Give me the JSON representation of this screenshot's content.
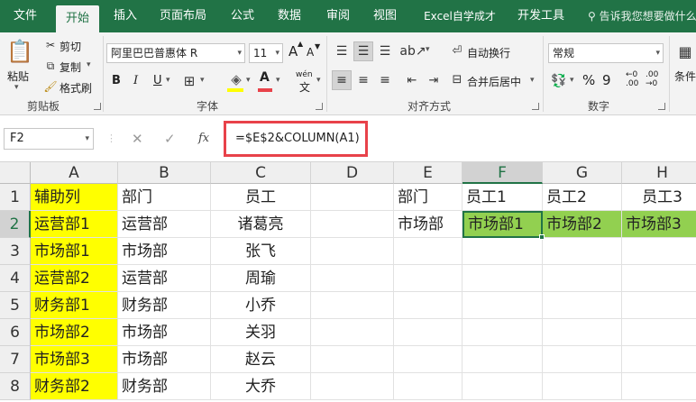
{
  "ribbon_tabs": [
    "文件",
    "开始",
    "插入",
    "页面布局",
    "公式",
    "数据",
    "审阅",
    "视图",
    "Excel自学成才",
    "开发工具"
  ],
  "active_tab": "开始",
  "tell_me": "告诉我您想要做什么...",
  "clipboard": {
    "paste": "粘贴",
    "cut": "剪切",
    "copy": "复制",
    "format_painter": "格式刷",
    "group_label": "剪贴板"
  },
  "font": {
    "name": "阿里巴巴普惠体 R",
    "size": "11",
    "bold": "B",
    "italic": "I",
    "underline": "U",
    "phonetic": "wén",
    "grow": "A",
    "shrink": "A",
    "font_color_letter": "A",
    "group_label": "字体"
  },
  "alignment": {
    "wrap_text": "自动换行",
    "merge_center": "合并后居中",
    "group_label": "对齐方式"
  },
  "number": {
    "format": "常规",
    "percent": "%",
    "comma": "9",
    "group_label": "数字"
  },
  "styles": {
    "conditional": "条件"
  },
  "formula_bar": {
    "name_box": "F2",
    "cancel": "✕",
    "enter": "✓",
    "fx": "fx",
    "formula": "=$E$2&COLUMN(A1)"
  },
  "columns": [
    "A",
    "B",
    "C",
    "D",
    "E",
    "F",
    "G",
    "H"
  ],
  "rows": [
    "1",
    "2",
    "3",
    "4",
    "5",
    "6",
    "7",
    "8"
  ],
  "selected_column": "F",
  "selected_row": "2",
  "cells": {
    "A": [
      "辅助列",
      "运营部1",
      "市场部1",
      "运营部2",
      "财务部1",
      "市场部2",
      "市场部3",
      "财务部2"
    ],
    "B": [
      "部门",
      "运营部",
      "市场部",
      "运营部",
      "财务部",
      "市场部",
      "市场部",
      "财务部"
    ],
    "C": [
      "员工",
      "诸葛亮",
      "张飞",
      "周瑜",
      "小乔",
      "关羽",
      "赵云",
      "大乔"
    ],
    "E": [
      "部门",
      "市场部"
    ],
    "F": [
      "员工1",
      "市场部1"
    ],
    "G": [
      "员工2",
      "市场部2"
    ],
    "H": [
      "员工3",
      "市场部3"
    ]
  },
  "colors": {
    "ribbon_green": "#217346",
    "helper_yellow": "#ffff00",
    "result_green": "#92d050",
    "highlight_red": "#e8424a"
  }
}
